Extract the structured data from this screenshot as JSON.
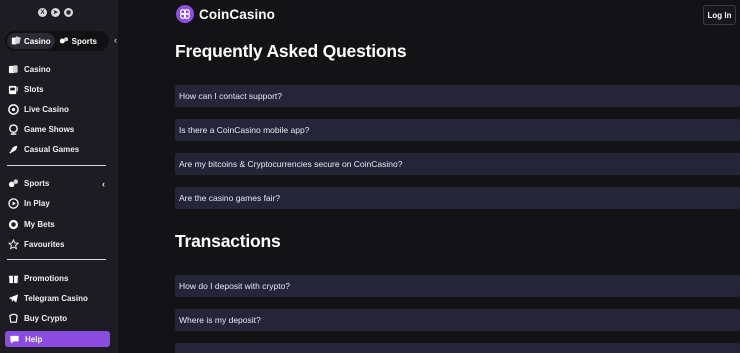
{
  "sidebar": {
    "social": [
      {
        "icon": "x-icon",
        "glyph": "X"
      },
      {
        "icon": "telegram-icon",
        "glyph": "➤"
      },
      {
        "icon": "discord-icon",
        "glyph": "◉"
      }
    ],
    "toggle": {
      "casino": "Casino",
      "sports": "Sports"
    },
    "collapse_glyph": "‹",
    "casino_items": [
      "Casino",
      "Slots",
      "Live Casino",
      "Game Shows",
      "Casual Games"
    ],
    "sports_header": "Sports",
    "sports_chevron": "‹",
    "sports_items": [
      "In Play",
      "My Bets",
      "Favourites"
    ],
    "extra_items": [
      "Promotions",
      "Telegram Casino",
      "Buy Crypto"
    ],
    "help": "Help"
  },
  "header": {
    "brand": "CoinCasino",
    "login": "Log In"
  },
  "main": {
    "faq_title": "Frequently Asked Questions",
    "faq_items": [
      "How can I contact support?",
      "Is there a CoinCasino mobile app?",
      "Are my bitcoins & Cryptocurrencies secure on CoinCasino?",
      "Are the casino games fair?"
    ],
    "transactions_title": "Transactions",
    "transactions_items": [
      "How do I deposit with crypto?",
      "Where is my deposit?"
    ]
  },
  "colors": {
    "accent": "#8a4de0",
    "row_bg": "#25253a",
    "sidebar_bg": "#1c1c22",
    "page_bg": "#131316"
  }
}
